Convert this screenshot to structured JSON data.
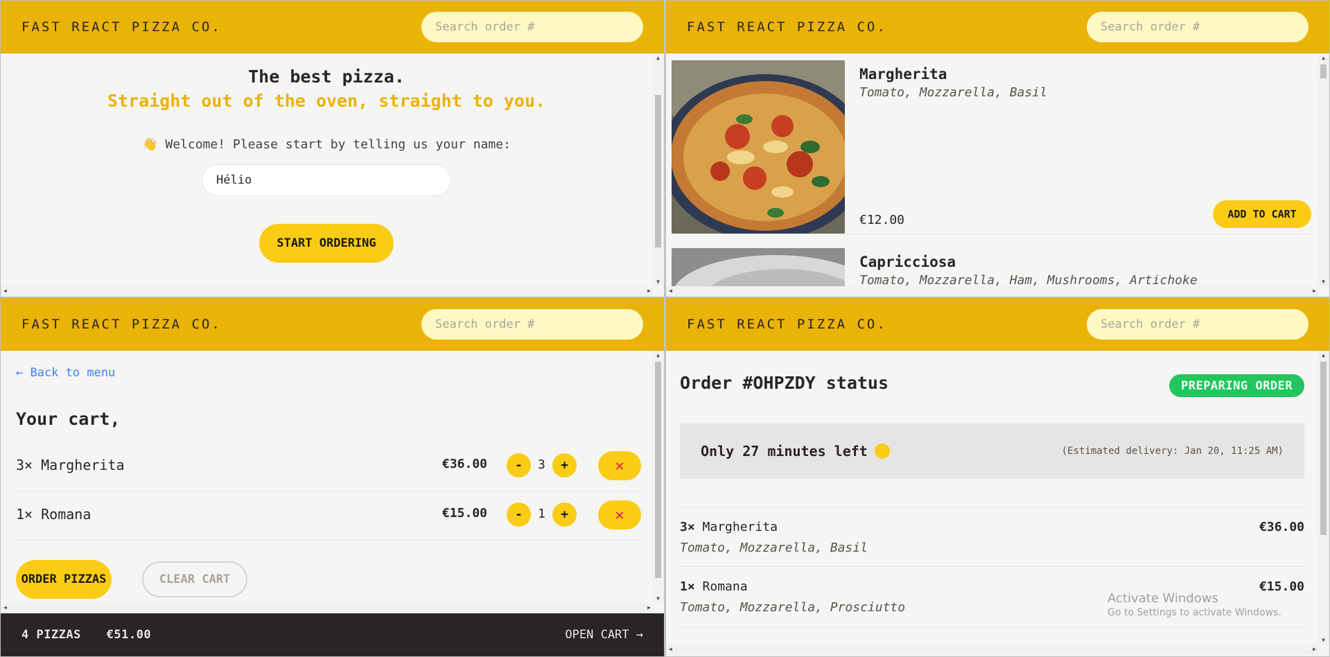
{
  "header": {
    "logo": "FAST REACT PIZZA CO.",
    "search_placeholder": "Search order #"
  },
  "home": {
    "title": "The best pizza.",
    "subtitle": "Straight out of the oven, straight to you.",
    "welcome": "👋 Welcome! Please start by telling us your name:",
    "name_value": "Hélio",
    "start_label": "START ORDERING"
  },
  "menu": {
    "items": [
      {
        "name": "Margherita",
        "ingredients": "Tomato, Mozzarella, Basil",
        "price": "€12.00",
        "add_label": "ADD TO CART"
      },
      {
        "name": "Capricciosa",
        "ingredients": "Tomato, Mozzarella, Ham, Mushrooms, Artichoke"
      }
    ]
  },
  "cart": {
    "back_label": "← Back to menu",
    "title": "Your cart,",
    "items": [
      {
        "name": "3× Margherita",
        "price": "€36.00",
        "qty": "3"
      },
      {
        "name": "1× Romana",
        "price": "€15.00",
        "qty": "1"
      }
    ],
    "minus": "-",
    "plus": "+",
    "delete": "✕",
    "order_label": "ORDER PIZZAS",
    "clear_label": "CLEAR CART",
    "bar_count": "4 PIZZAS",
    "bar_total": "€51.00",
    "bar_open": "OPEN CART →"
  },
  "order": {
    "title": "Order #OHPZDY status",
    "status": "PREPARING ORDER",
    "eta": "Only 27 minutes left",
    "estimated": "(Estimated delivery: Jan 20, 11:25 AM)",
    "items": [
      {
        "qty": "3×",
        "name": "Margherita",
        "price": "€36.00",
        "ingredients": "Tomato, Mozzarella, Basil"
      },
      {
        "qty": "1×",
        "name": "Romana",
        "price": "€15.00",
        "ingredients": "Tomato, Mozzarella, Prosciutto"
      }
    ]
  },
  "watermark": {
    "line1": "Activate Windows",
    "line2": "Go to Settings to activate Windows."
  },
  "colors": {
    "brand": "#eab308",
    "button": "#facc15",
    "success": "#22c55e",
    "dark": "#292524"
  }
}
